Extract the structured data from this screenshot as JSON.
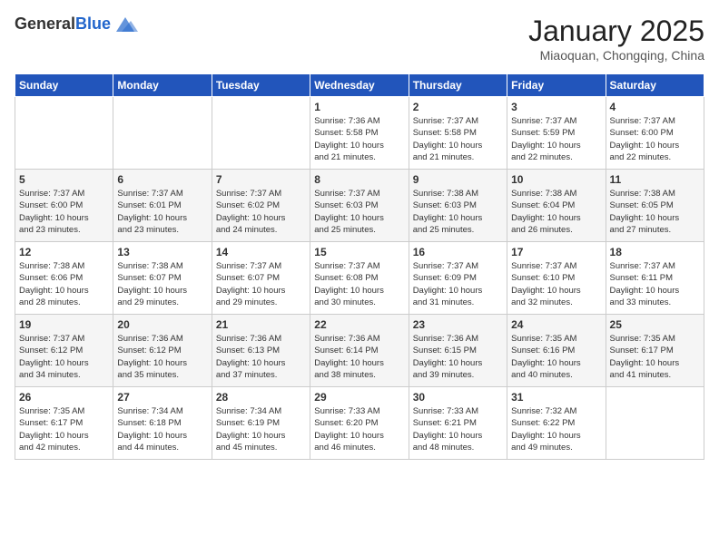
{
  "header": {
    "logo_general": "General",
    "logo_blue": "Blue",
    "title": "January 2025",
    "subtitle": "Miaoquan, Chongqing, China"
  },
  "weekdays": [
    "Sunday",
    "Monday",
    "Tuesday",
    "Wednesday",
    "Thursday",
    "Friday",
    "Saturday"
  ],
  "weeks": [
    [
      {
        "day": "",
        "info": ""
      },
      {
        "day": "",
        "info": ""
      },
      {
        "day": "",
        "info": ""
      },
      {
        "day": "1",
        "info": "Sunrise: 7:36 AM\nSunset: 5:58 PM\nDaylight: 10 hours\nand 21 minutes."
      },
      {
        "day": "2",
        "info": "Sunrise: 7:37 AM\nSunset: 5:58 PM\nDaylight: 10 hours\nand 21 minutes."
      },
      {
        "day": "3",
        "info": "Sunrise: 7:37 AM\nSunset: 5:59 PM\nDaylight: 10 hours\nand 22 minutes."
      },
      {
        "day": "4",
        "info": "Sunrise: 7:37 AM\nSunset: 6:00 PM\nDaylight: 10 hours\nand 22 minutes."
      }
    ],
    [
      {
        "day": "5",
        "info": "Sunrise: 7:37 AM\nSunset: 6:00 PM\nDaylight: 10 hours\nand 23 minutes."
      },
      {
        "day": "6",
        "info": "Sunrise: 7:37 AM\nSunset: 6:01 PM\nDaylight: 10 hours\nand 23 minutes."
      },
      {
        "day": "7",
        "info": "Sunrise: 7:37 AM\nSunset: 6:02 PM\nDaylight: 10 hours\nand 24 minutes."
      },
      {
        "day": "8",
        "info": "Sunrise: 7:37 AM\nSunset: 6:03 PM\nDaylight: 10 hours\nand 25 minutes."
      },
      {
        "day": "9",
        "info": "Sunrise: 7:38 AM\nSunset: 6:03 PM\nDaylight: 10 hours\nand 25 minutes."
      },
      {
        "day": "10",
        "info": "Sunrise: 7:38 AM\nSunset: 6:04 PM\nDaylight: 10 hours\nand 26 minutes."
      },
      {
        "day": "11",
        "info": "Sunrise: 7:38 AM\nSunset: 6:05 PM\nDaylight: 10 hours\nand 27 minutes."
      }
    ],
    [
      {
        "day": "12",
        "info": "Sunrise: 7:38 AM\nSunset: 6:06 PM\nDaylight: 10 hours\nand 28 minutes."
      },
      {
        "day": "13",
        "info": "Sunrise: 7:38 AM\nSunset: 6:07 PM\nDaylight: 10 hours\nand 29 minutes."
      },
      {
        "day": "14",
        "info": "Sunrise: 7:37 AM\nSunset: 6:07 PM\nDaylight: 10 hours\nand 29 minutes."
      },
      {
        "day": "15",
        "info": "Sunrise: 7:37 AM\nSunset: 6:08 PM\nDaylight: 10 hours\nand 30 minutes."
      },
      {
        "day": "16",
        "info": "Sunrise: 7:37 AM\nSunset: 6:09 PM\nDaylight: 10 hours\nand 31 minutes."
      },
      {
        "day": "17",
        "info": "Sunrise: 7:37 AM\nSunset: 6:10 PM\nDaylight: 10 hours\nand 32 minutes."
      },
      {
        "day": "18",
        "info": "Sunrise: 7:37 AM\nSunset: 6:11 PM\nDaylight: 10 hours\nand 33 minutes."
      }
    ],
    [
      {
        "day": "19",
        "info": "Sunrise: 7:37 AM\nSunset: 6:12 PM\nDaylight: 10 hours\nand 34 minutes."
      },
      {
        "day": "20",
        "info": "Sunrise: 7:36 AM\nSunset: 6:12 PM\nDaylight: 10 hours\nand 35 minutes."
      },
      {
        "day": "21",
        "info": "Sunrise: 7:36 AM\nSunset: 6:13 PM\nDaylight: 10 hours\nand 37 minutes."
      },
      {
        "day": "22",
        "info": "Sunrise: 7:36 AM\nSunset: 6:14 PM\nDaylight: 10 hours\nand 38 minutes."
      },
      {
        "day": "23",
        "info": "Sunrise: 7:36 AM\nSunset: 6:15 PM\nDaylight: 10 hours\nand 39 minutes."
      },
      {
        "day": "24",
        "info": "Sunrise: 7:35 AM\nSunset: 6:16 PM\nDaylight: 10 hours\nand 40 minutes."
      },
      {
        "day": "25",
        "info": "Sunrise: 7:35 AM\nSunset: 6:17 PM\nDaylight: 10 hours\nand 41 minutes."
      }
    ],
    [
      {
        "day": "26",
        "info": "Sunrise: 7:35 AM\nSunset: 6:17 PM\nDaylight: 10 hours\nand 42 minutes."
      },
      {
        "day": "27",
        "info": "Sunrise: 7:34 AM\nSunset: 6:18 PM\nDaylight: 10 hours\nand 44 minutes."
      },
      {
        "day": "28",
        "info": "Sunrise: 7:34 AM\nSunset: 6:19 PM\nDaylight: 10 hours\nand 45 minutes."
      },
      {
        "day": "29",
        "info": "Sunrise: 7:33 AM\nSunset: 6:20 PM\nDaylight: 10 hours\nand 46 minutes."
      },
      {
        "day": "30",
        "info": "Sunrise: 7:33 AM\nSunset: 6:21 PM\nDaylight: 10 hours\nand 48 minutes."
      },
      {
        "day": "31",
        "info": "Sunrise: 7:32 AM\nSunset: 6:22 PM\nDaylight: 10 hours\nand 49 minutes."
      },
      {
        "day": "",
        "info": ""
      }
    ]
  ]
}
